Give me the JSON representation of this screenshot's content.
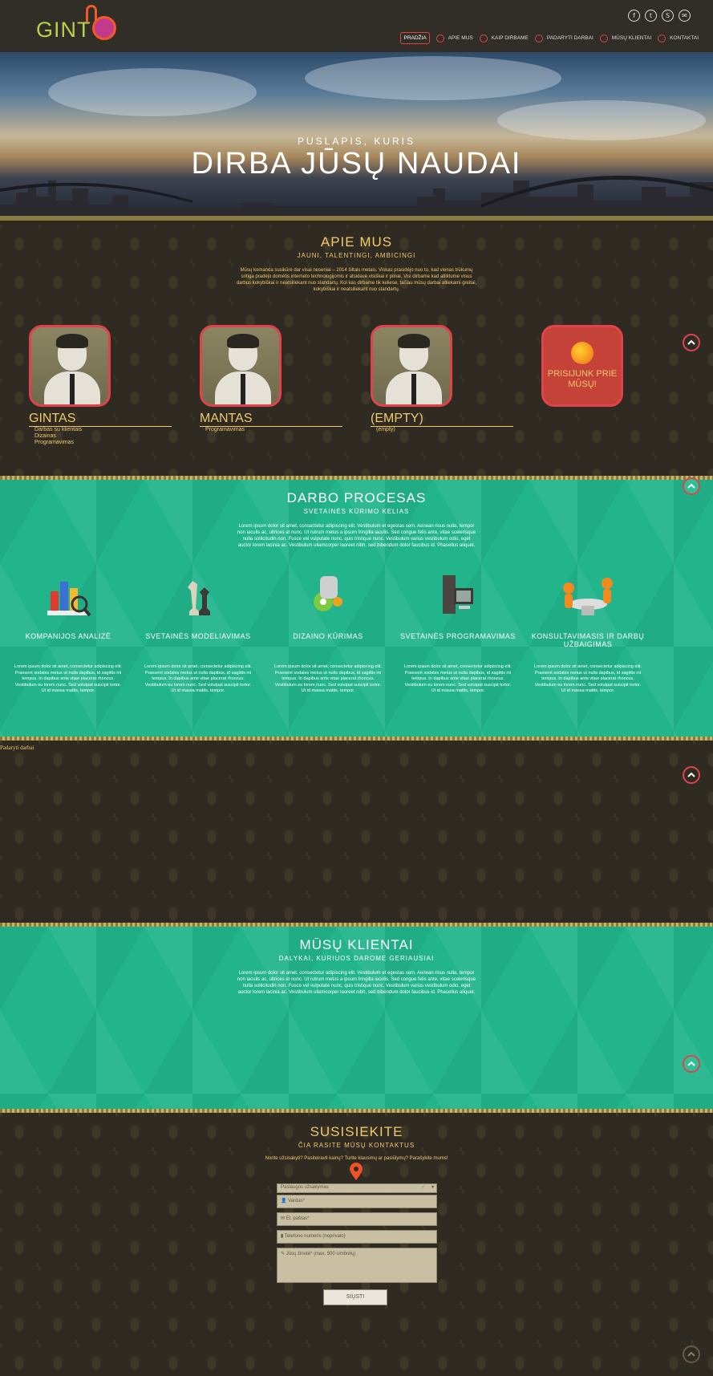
{
  "header": {
    "logo_text": "GINT",
    "socials": [
      "facebook-icon",
      "twitter-icon",
      "skype-icon",
      "email-icon"
    ],
    "nav": [
      "PRADŽIA",
      "APIE MUS",
      "KAIP DIRBAME",
      "PADARYTI DARBAI",
      "MŪSŲ KLIENTAI",
      "KONTAKTAI"
    ]
  },
  "hero": {
    "subtitle": "PUSLAPIS, KURIS",
    "title": "DIRBA JŪSŲ NAUDAI"
  },
  "about": {
    "title": "APIE MUS",
    "subtitle": "JAUNI, TALENTINGI, AMBICINGI",
    "paragraph": "Mūsų komanda susikūrė dar visai neseniai – 2014 šiltais metais. Viskas prasidėjo nuo to, kad vienas trūkumų sritiga pradėjo domėtis interneto technologijomis ir atsidavė visiškai ir pilnai. Visi dirbame kad atliktume visus darbus kokybiškai ir neatsiliekant nuo standartų. Kol kas dirbame tik keliese, tačiau mūsų darbai atliekami greitai, kokybiškai ir neatsiliekant nuo standartų.",
    "members": [
      {
        "name": "GINTAS",
        "roles": [
          "Darbas su klientais",
          "Dizainas",
          "Programavimas"
        ]
      },
      {
        "name": "MANTAS",
        "roles": [
          "Programavimas"
        ]
      },
      {
        "name": "(EMPTY)",
        "roles": [
          "(empty)"
        ]
      }
    ],
    "join_text": "PRISIJUNK PRIE MŪSŲ!"
  },
  "process": {
    "title": "DARBO PROCESAS",
    "subtitle": "SVETAINĖS KŪRIMO KELIAS",
    "paragraph": "Lorem ipsum dolor sit amet, consectetur adipiscing elit. Vestibulum et egestas sem. Aenean risus nulla, tempor non iaculis ac, ultrices at nunc. Ut rutrum metus a ipsum fringilla iaculis. Sed congue felis ante, vitae scelerisque nulla sollicitudin non. Fusce vel vulputate nunc, quis tristique nunc. Vestibulum varius vestibulum odio, eget auctor lorem lacinia ac. Vestibulum ullamcorper laoreet nibh, sed bibendum dolor faucibus id. Phasellus aliquet.",
    "steps": [
      {
        "title": "KOMPANIJOS ANALIZĖ",
        "icon": "chart-analysis-icon",
        "text": "Lorem ipsum dolor sit amet, consectetur adipiscing elit. Praesent sodales metus ut nulla dapibus, id sagittis mi tempus. In dapibus ante vitae placerat rhoncus. Vestibulum eu lorem nunc. Sed volutpat suscipit tortor. Ut id massa mattis, tempor."
      },
      {
        "title": "SVETAINĖS MODELIAVIMAS",
        "icon": "chess-icon",
        "text": "Lorem ipsum dolor sit amet, consectetur adipiscing elit. Praesent sodales metus ut nulla dapibus, id sagittis mi tempus. In dapibus ante vitae placerat rhoncus. Vestibulum eu lorem nunc. Sed volutpat suscipit tortor. Ut id massa mattis, tempor."
      },
      {
        "title": "DIZAINO KŪRIMAS",
        "icon": "design-icon",
        "text": "Lorem ipsum dolor sit amet, consectetur adipiscing elit. Praesent sodales metus ut nulla dapibus, id sagittis mi tempus. In dapibus ante vitae placerat rhoncus. Vestibulum eu lorem nunc. Sed volutpat suscipit tortor. Ut id massa mattis, tempor."
      },
      {
        "title": "SVETAINĖS PROGRAMAVIMAS",
        "icon": "computer-icon",
        "text": "Lorem ipsum dolor sit amet, consectetur adipiscing elit. Praesent sodales metus ut nulla dapibus, id sagittis mi tempus. In dapibus ante vitae placerat rhoncus. Vestibulum eu lorem nunc. Sed volutpat suscipit tortor. Ut id massa mattis, tempor."
      },
      {
        "title": "KONSULTAVIMASIS IR DARBŲ UŽBAIGIMAS",
        "icon": "meeting-icon",
        "text": "Lorem ipsum dolor sit amet, consectetur adipiscing elit. Praesent sodales metus ut nulla dapibus, id sagittis mi tempus. In dapibus ante vitae placerat rhoncus. Vestibulum eu lorem nunc. Sed volutpat suscipit tortor. Ut id massa mattis, tempor."
      }
    ]
  },
  "works": {
    "label": "Padaryti darbai"
  },
  "clients": {
    "title": "MŪSŲ KLIENTAI",
    "subtitle": "DALYKAI, KURIUOS DAROME GERIAUSIAI",
    "paragraph": "Lorem ipsum dolor sit amet, consectetur adipiscing elit. Vestibulum et egestas sem. Aenean risus nulla, tempor non iaculis ac, ultrices at nunc. Ut rutrum metus a ipsum fringilla iaculis. Sed congue felis ante, vitae scelerisque nulla sollicitudin non. Fusce vel vulputate nunc, quis tristique nunc. Vestibulum varius vestibulum odio, eget auctor lorem lacinia ac. Vestibulum ullamcorper laoreet nibh, sed bibendum dolor faucibus id. Phasellus aliquet."
  },
  "contact": {
    "title": "SUSISIEKITE",
    "subtitle": "ČIA RASITE MŪSŲ KONTAKTUS",
    "intro": "Norite užsisakyti? Pasiteiravti kainų? Turite klausimų ar pasiūlymų? Parašykite mums!",
    "select_placeholder": "Paslaugos užsakymas",
    "name_placeholder": "Vardas*",
    "email_placeholder": "El. paštas*",
    "phone_placeholder": "Telefono numeris (neprivalo)",
    "message_placeholder": "Jūsų žinutė* (max. 500 simbolių)",
    "send_label": "SIŲSTI"
  },
  "colors": {
    "accent": "#e0434c",
    "gold": "#f3c86a",
    "green": "#22b58b",
    "dark": "#2f2b22"
  }
}
